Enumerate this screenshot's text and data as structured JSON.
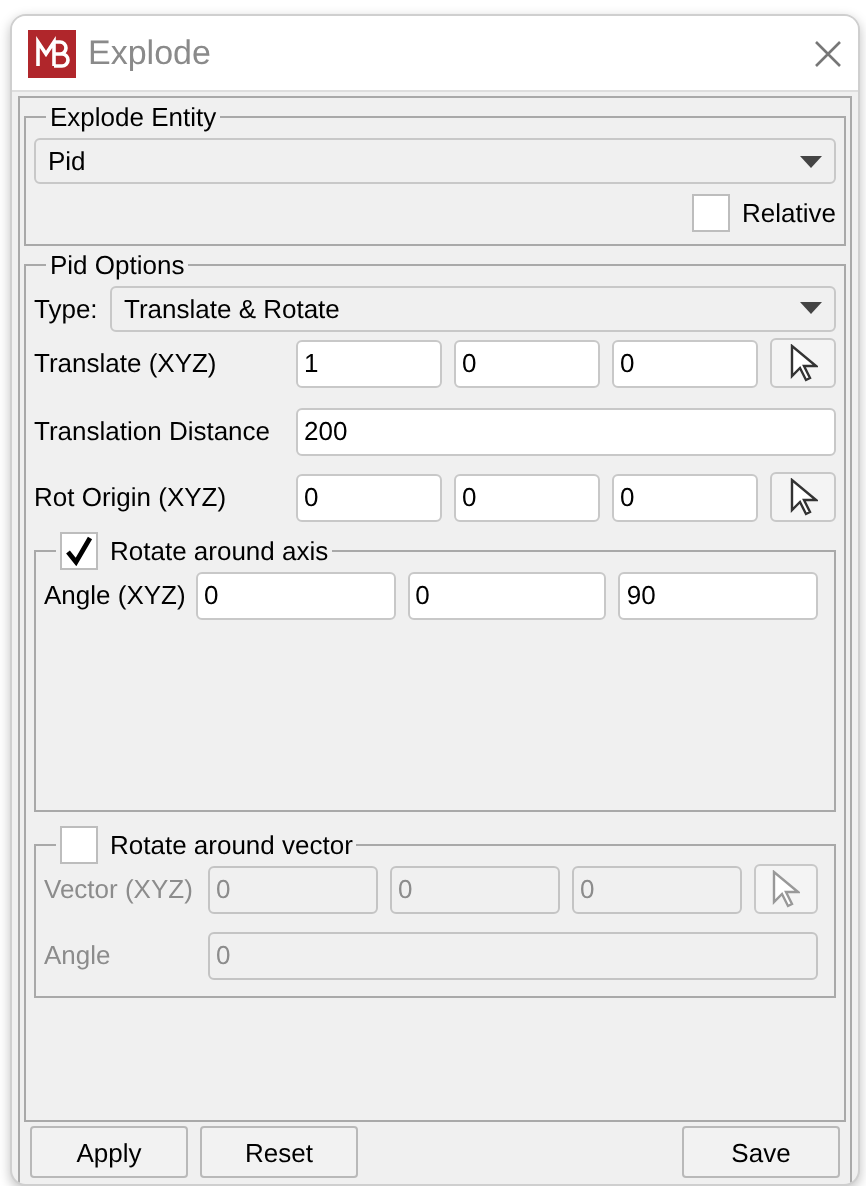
{
  "window": {
    "title": "Explode"
  },
  "explode_entity": {
    "title": "Explode Entity",
    "value": "Pid",
    "relative": {
      "label": "Relative",
      "checked": false
    }
  },
  "pid_options": {
    "title": "Pid Options",
    "type_label": "Type:",
    "type_value": "Translate & Rotate",
    "translate": {
      "label": "Translate (XYZ)",
      "values": [
        "1",
        "0",
        "0"
      ]
    },
    "translation_distance": {
      "label": "Translation Distance",
      "value": "200"
    },
    "rot_origin": {
      "label": "Rot Origin (XYZ)",
      "values": [
        "0",
        "0",
        "0"
      ]
    },
    "rotate_axis": {
      "label": "Rotate around axis",
      "checked": true,
      "angle": {
        "label": "Angle (XYZ)",
        "values": [
          "0",
          "0",
          "90"
        ]
      }
    },
    "rotate_vector": {
      "label": "Rotate around vector",
      "checked": false,
      "vector": {
        "label": "Vector (XYZ)",
        "values": [
          "0",
          "0",
          "0"
        ]
      },
      "angle": {
        "label": "Angle",
        "value": "0"
      }
    }
  },
  "buttons": [
    {
      "label": "Apply"
    },
    {
      "label": "Reset"
    },
    {
      "label": "Save"
    }
  ]
}
